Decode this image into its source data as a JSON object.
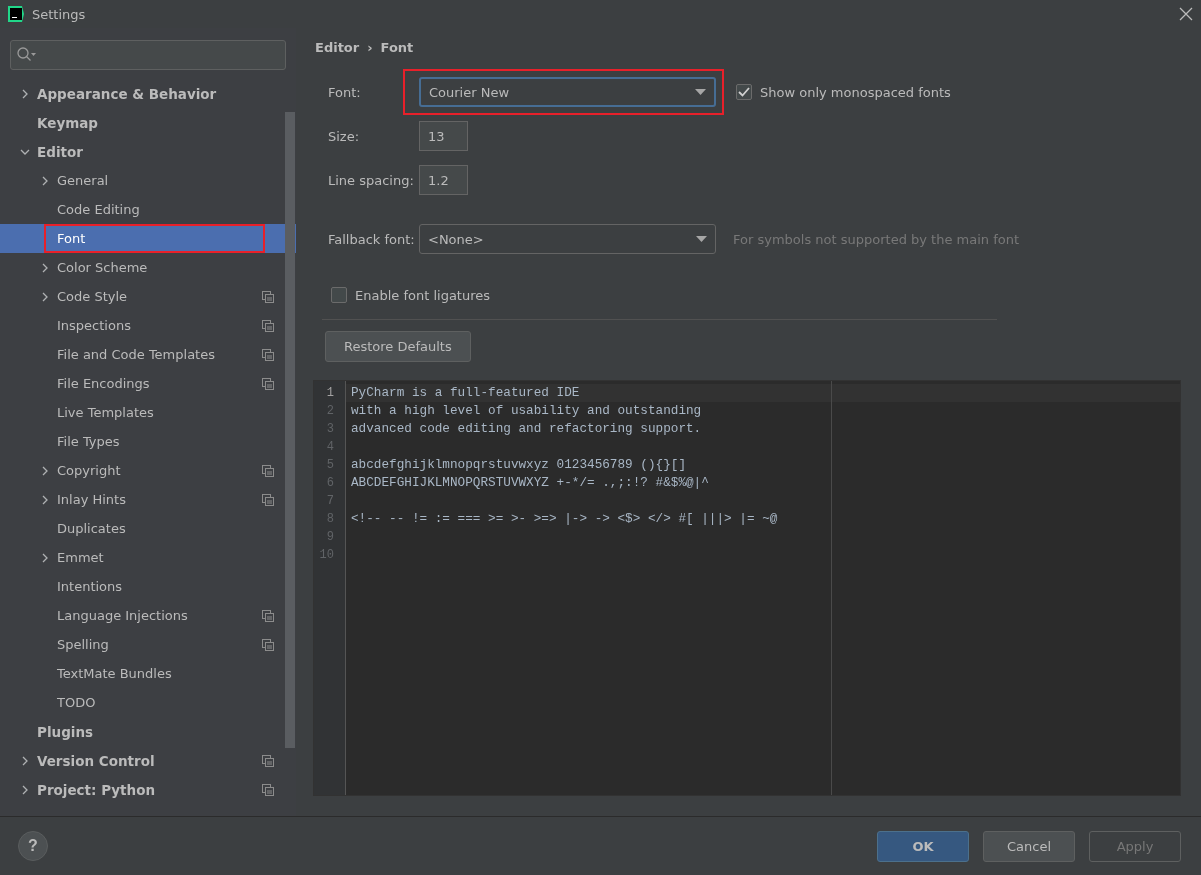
{
  "window": {
    "title": "Settings"
  },
  "sidebar": {
    "items": [
      {
        "label": "Appearance & Behavior",
        "bold": true,
        "expanded": false,
        "selected": false,
        "highlighted": false,
        "project_scoped": false
      },
      {
        "label": "Keymap",
        "bold": true,
        "selected": false,
        "highlighted": false,
        "project_scoped": false
      },
      {
        "label": "Editor",
        "bold": true,
        "expanded": true,
        "selected": false,
        "highlighted": false,
        "project_scoped": false,
        "children": [
          {
            "label": "General",
            "expanded": false,
            "selected": false,
            "highlighted": false,
            "project_scoped": false
          },
          {
            "label": "Code Editing",
            "selected": false,
            "highlighted": false,
            "project_scoped": false
          },
          {
            "label": "Font",
            "selected": true,
            "highlighted": true,
            "project_scoped": false
          },
          {
            "label": "Color Scheme",
            "expanded": false,
            "selected": false,
            "highlighted": false,
            "project_scoped": false
          },
          {
            "label": "Code Style",
            "expanded": false,
            "selected": false,
            "highlighted": false,
            "project_scoped": true
          },
          {
            "label": "Inspections",
            "selected": false,
            "highlighted": false,
            "project_scoped": true
          },
          {
            "label": "File and Code Templates",
            "selected": false,
            "highlighted": false,
            "project_scoped": true
          },
          {
            "label": "File Encodings",
            "selected": false,
            "highlighted": false,
            "project_scoped": true
          },
          {
            "label": "Live Templates",
            "selected": false,
            "highlighted": false,
            "project_scoped": false
          },
          {
            "label": "File Types",
            "selected": false,
            "highlighted": false,
            "project_scoped": false
          },
          {
            "label": "Copyright",
            "expanded": false,
            "selected": false,
            "highlighted": false,
            "project_scoped": true
          },
          {
            "label": "Inlay Hints",
            "expanded": false,
            "selected": false,
            "highlighted": false,
            "project_scoped": true
          },
          {
            "label": "Duplicates",
            "selected": false,
            "highlighted": false,
            "project_scoped": false
          },
          {
            "label": "Emmet",
            "expanded": false,
            "selected": false,
            "highlighted": false,
            "project_scoped": false
          },
          {
            "label": "Intentions",
            "selected": false,
            "highlighted": false,
            "project_scoped": false
          },
          {
            "label": "Language Injections",
            "selected": false,
            "highlighted": false,
            "project_scoped": true
          },
          {
            "label": "Spelling",
            "selected": false,
            "highlighted": false,
            "project_scoped": true
          },
          {
            "label": "TextMate Bundles",
            "selected": false,
            "highlighted": false,
            "project_scoped": false
          },
          {
            "label": "TODO",
            "selected": false,
            "highlighted": false,
            "project_scoped": false
          }
        ]
      },
      {
        "label": "Plugins",
        "bold": true,
        "selected": false,
        "highlighted": false,
        "project_scoped": false
      },
      {
        "label": "Version Control",
        "bold": true,
        "expanded": false,
        "selected": false,
        "highlighted": false,
        "project_scoped": true
      },
      {
        "label": "Project: Python",
        "bold": true,
        "expanded": false,
        "selected": false,
        "highlighted": false,
        "project_scoped": true
      }
    ]
  },
  "breadcrumb": {
    "items": [
      "Editor",
      "Font"
    ],
    "separator": "›"
  },
  "form": {
    "font": {
      "label": "Font:",
      "value": "Courier New",
      "highlighted": true
    },
    "monospaced": {
      "label": "Show only monospaced fonts",
      "checked": true
    },
    "size": {
      "label": "Size:",
      "value": "13"
    },
    "line_spacing": {
      "label": "Line spacing:",
      "value": "1.2"
    },
    "fallback": {
      "label": "Fallback font:",
      "value": "<None>",
      "hint": "For symbols not supported by the main font"
    },
    "ligatures": {
      "label": "Enable font ligatures",
      "checked": false
    },
    "restore_button": "Restore Defaults"
  },
  "preview": {
    "lines": [
      {
        "number": "1",
        "text": "PyCharm is a full-featured IDE",
        "current": true
      },
      {
        "number": "2",
        "text": "with a high level of usability and outstanding",
        "current": false
      },
      {
        "number": "3",
        "text": "advanced code editing and refactoring support.",
        "current": false
      },
      {
        "number": "4",
        "current": false
      },
      {
        "number": "5",
        "text": "abcdefghijklmnopqrstuvwxyz 0123456789 (){}[]",
        "current": false
      },
      {
        "number": "6",
        "text": "ABCDEFGHIJKLMNOPQRSTUVWXYZ +-*/= .,;:!? #&$%@|^",
        "current": false
      },
      {
        "number": "7",
        "current": false
      },
      {
        "number": "8",
        "text": "<!-- -- != := === >= >- >=> |-> -> <$> </> #[ |||> |= ~@",
        "current": false
      },
      {
        "number": "9",
        "current": false
      },
      {
        "number": "10",
        "current": false
      }
    ]
  },
  "footer": {
    "help": "?",
    "buttons": [
      {
        "label": "OK",
        "kind": "primary",
        "disabled": false
      },
      {
        "label": "Cancel",
        "kind": "normal",
        "disabled": false
      },
      {
        "label": "Apply",
        "kind": "normal",
        "disabled": true
      }
    ]
  }
}
